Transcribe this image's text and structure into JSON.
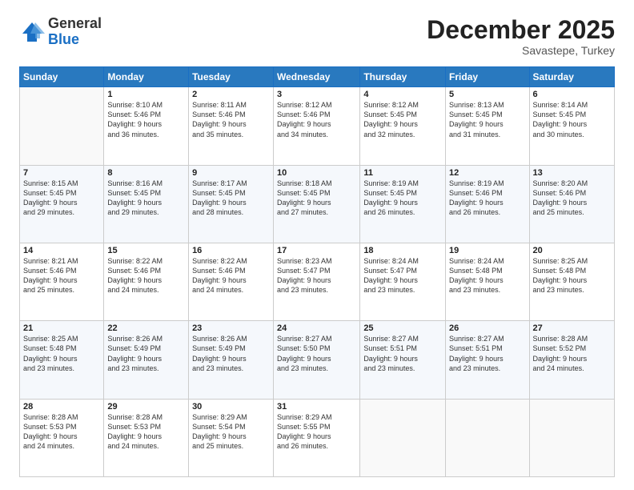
{
  "logo": {
    "general": "General",
    "blue": "Blue"
  },
  "title": "December 2025",
  "subtitle": "Savastepe, Turkey",
  "days": [
    "Sunday",
    "Monday",
    "Tuesday",
    "Wednesday",
    "Thursday",
    "Friday",
    "Saturday"
  ],
  "weeks": [
    [
      {
        "num": "",
        "content": ""
      },
      {
        "num": "1",
        "content": "Sunrise: 8:10 AM\nSunset: 5:46 PM\nDaylight: 9 hours\nand 36 minutes."
      },
      {
        "num": "2",
        "content": "Sunrise: 8:11 AM\nSunset: 5:46 PM\nDaylight: 9 hours\nand 35 minutes."
      },
      {
        "num": "3",
        "content": "Sunrise: 8:12 AM\nSunset: 5:46 PM\nDaylight: 9 hours\nand 34 minutes."
      },
      {
        "num": "4",
        "content": "Sunrise: 8:12 AM\nSunset: 5:45 PM\nDaylight: 9 hours\nand 32 minutes."
      },
      {
        "num": "5",
        "content": "Sunrise: 8:13 AM\nSunset: 5:45 PM\nDaylight: 9 hours\nand 31 minutes."
      },
      {
        "num": "6",
        "content": "Sunrise: 8:14 AM\nSunset: 5:45 PM\nDaylight: 9 hours\nand 30 minutes."
      }
    ],
    [
      {
        "num": "7",
        "content": "Sunrise: 8:15 AM\nSunset: 5:45 PM\nDaylight: 9 hours\nand 29 minutes."
      },
      {
        "num": "8",
        "content": "Sunrise: 8:16 AM\nSunset: 5:45 PM\nDaylight: 9 hours\nand 29 minutes."
      },
      {
        "num": "9",
        "content": "Sunrise: 8:17 AM\nSunset: 5:45 PM\nDaylight: 9 hours\nand 28 minutes."
      },
      {
        "num": "10",
        "content": "Sunrise: 8:18 AM\nSunset: 5:45 PM\nDaylight: 9 hours\nand 27 minutes."
      },
      {
        "num": "11",
        "content": "Sunrise: 8:19 AM\nSunset: 5:45 PM\nDaylight: 9 hours\nand 26 minutes."
      },
      {
        "num": "12",
        "content": "Sunrise: 8:19 AM\nSunset: 5:46 PM\nDaylight: 9 hours\nand 26 minutes."
      },
      {
        "num": "13",
        "content": "Sunrise: 8:20 AM\nSunset: 5:46 PM\nDaylight: 9 hours\nand 25 minutes."
      }
    ],
    [
      {
        "num": "14",
        "content": "Sunrise: 8:21 AM\nSunset: 5:46 PM\nDaylight: 9 hours\nand 25 minutes."
      },
      {
        "num": "15",
        "content": "Sunrise: 8:22 AM\nSunset: 5:46 PM\nDaylight: 9 hours\nand 24 minutes."
      },
      {
        "num": "16",
        "content": "Sunrise: 8:22 AM\nSunset: 5:46 PM\nDaylight: 9 hours\nand 24 minutes."
      },
      {
        "num": "17",
        "content": "Sunrise: 8:23 AM\nSunset: 5:47 PM\nDaylight: 9 hours\nand 23 minutes."
      },
      {
        "num": "18",
        "content": "Sunrise: 8:24 AM\nSunset: 5:47 PM\nDaylight: 9 hours\nand 23 minutes."
      },
      {
        "num": "19",
        "content": "Sunrise: 8:24 AM\nSunset: 5:48 PM\nDaylight: 9 hours\nand 23 minutes."
      },
      {
        "num": "20",
        "content": "Sunrise: 8:25 AM\nSunset: 5:48 PM\nDaylight: 9 hours\nand 23 minutes."
      }
    ],
    [
      {
        "num": "21",
        "content": "Sunrise: 8:25 AM\nSunset: 5:48 PM\nDaylight: 9 hours\nand 23 minutes."
      },
      {
        "num": "22",
        "content": "Sunrise: 8:26 AM\nSunset: 5:49 PM\nDaylight: 9 hours\nand 23 minutes."
      },
      {
        "num": "23",
        "content": "Sunrise: 8:26 AM\nSunset: 5:49 PM\nDaylight: 9 hours\nand 23 minutes."
      },
      {
        "num": "24",
        "content": "Sunrise: 8:27 AM\nSunset: 5:50 PM\nDaylight: 9 hours\nand 23 minutes."
      },
      {
        "num": "25",
        "content": "Sunrise: 8:27 AM\nSunset: 5:51 PM\nDaylight: 9 hours\nand 23 minutes."
      },
      {
        "num": "26",
        "content": "Sunrise: 8:27 AM\nSunset: 5:51 PM\nDaylight: 9 hours\nand 23 minutes."
      },
      {
        "num": "27",
        "content": "Sunrise: 8:28 AM\nSunset: 5:52 PM\nDaylight: 9 hours\nand 24 minutes."
      }
    ],
    [
      {
        "num": "28",
        "content": "Sunrise: 8:28 AM\nSunset: 5:53 PM\nDaylight: 9 hours\nand 24 minutes."
      },
      {
        "num": "29",
        "content": "Sunrise: 8:28 AM\nSunset: 5:53 PM\nDaylight: 9 hours\nand 24 minutes."
      },
      {
        "num": "30",
        "content": "Sunrise: 8:29 AM\nSunset: 5:54 PM\nDaylight: 9 hours\nand 25 minutes."
      },
      {
        "num": "31",
        "content": "Sunrise: 8:29 AM\nSunset: 5:55 PM\nDaylight: 9 hours\nand 26 minutes."
      },
      {
        "num": "",
        "content": ""
      },
      {
        "num": "",
        "content": ""
      },
      {
        "num": "",
        "content": ""
      }
    ]
  ]
}
